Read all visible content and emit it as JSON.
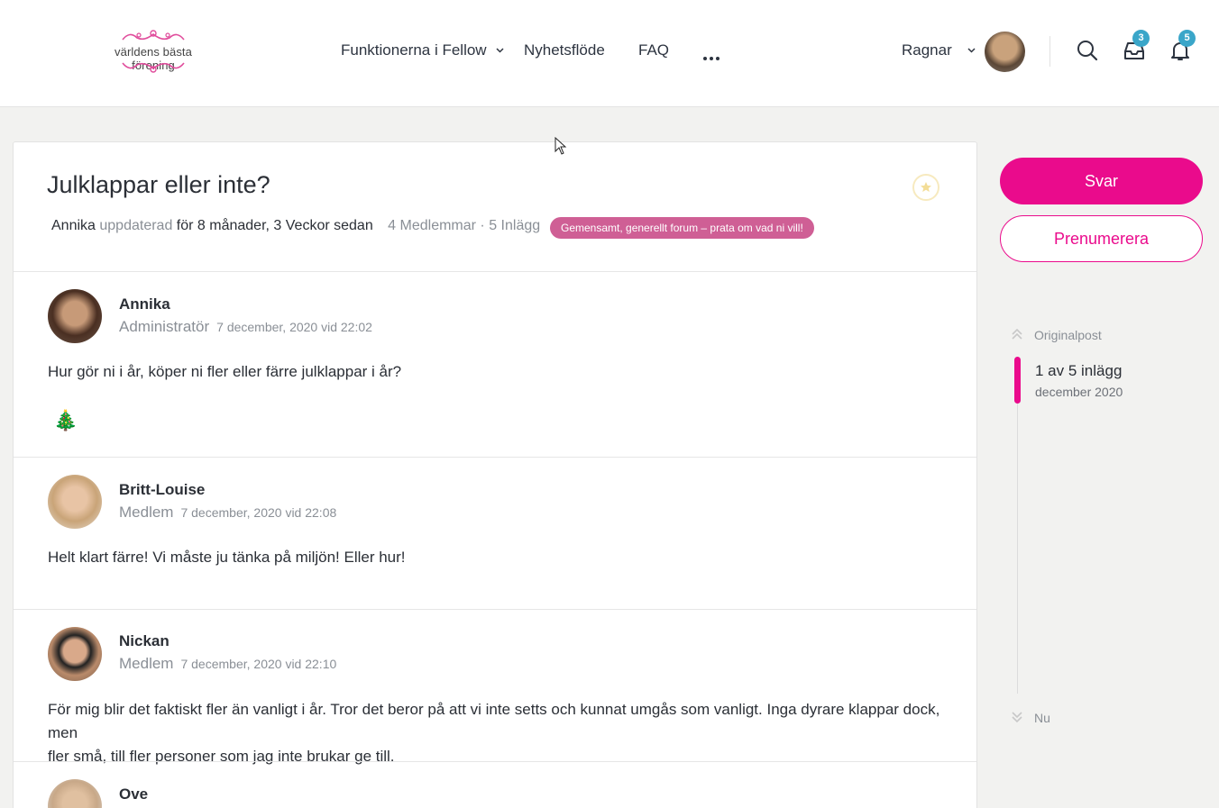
{
  "header": {
    "logo_text": "världens bästa förening",
    "nav": [
      {
        "label": "Funktionerna i Fellow"
      },
      {
        "label": "Nyhetsflöde"
      },
      {
        "label": "FAQ"
      }
    ],
    "user_name": "Ragnar",
    "inbox_count": "3",
    "notification_count": "5"
  },
  "topic": {
    "title": "Julklappar eller inte?",
    "author": "Annika",
    "updated_word": "uppdaterad",
    "updated_ago": "för 8 månader, 3 Veckor sedan",
    "stats": "4 Medlemmar · 5 Inlägg",
    "forum_tag": "Gemensamt, generellt forum – prata om vad ni vill!"
  },
  "posts": [
    {
      "name": "Annika",
      "role": "Administratör",
      "time": "7 december, 2020 vid 22:02",
      "text": "Hur gör ni i år, köper ni fler eller färre julklappar i år?",
      "emoji": "🎄"
    },
    {
      "name": "Britt-Louise",
      "role": "Medlem",
      "time": "7 december, 2020 vid 22:08",
      "text": "Helt klart färre! Vi måste ju tänka på miljön! Eller hur!"
    },
    {
      "name": "Nickan",
      "role": "Medlem",
      "time": "7 december, 2020 vid 22:10",
      "text_line1": "För mig blir det faktiskt fler än vanligt i år. Tror det beror på att vi inte setts och kunnat umgås som vanligt. Inga dyrare klappar dock, men",
      "text_line2": "fler små, till fler personer som jag inte brukar ge till."
    },
    {
      "name": "Ove"
    }
  ],
  "sidebar": {
    "reply_label": "Svar",
    "subscribe_label": "Prenumerera",
    "timeline_top": "Originalpost",
    "timeline_position": "1 av 5 inlägg",
    "timeline_date": "december 2020",
    "timeline_bottom": "Nu"
  },
  "colors": {
    "accent": "#ea0b8c",
    "tag": "#cf5f95",
    "badge": "#3aa6c9"
  }
}
